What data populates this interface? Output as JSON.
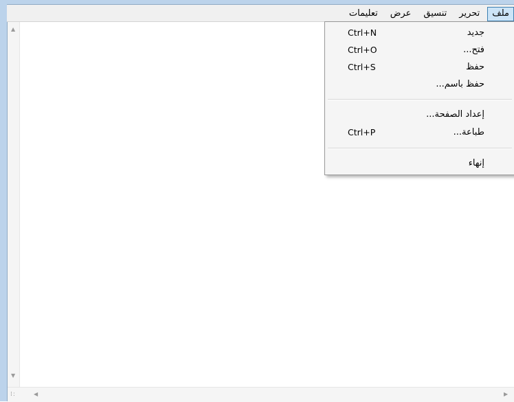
{
  "menubar": {
    "items": [
      {
        "label": "ملف",
        "active": true
      },
      {
        "label": "تحرير"
      },
      {
        "label": "تنسيق"
      },
      {
        "label": "عرض"
      },
      {
        "label": "تعليمات"
      }
    ]
  },
  "file_menu": {
    "new": {
      "label": "جديد",
      "shortcut": "Ctrl+N"
    },
    "open": {
      "label": "فتح...",
      "shortcut": "Ctrl+O"
    },
    "save": {
      "label": "حفظ",
      "shortcut": "Ctrl+S"
    },
    "save_as": {
      "label": "حفظ باسم..."
    },
    "page_setup": {
      "label": "إعداد الصفحة..."
    },
    "print": {
      "label": "طباعة...",
      "shortcut": "Ctrl+P"
    },
    "exit": {
      "label": "إنهاء"
    }
  },
  "editor": {
    "content": ""
  },
  "colors": {
    "frame": "#bcd3eb",
    "menu_active_bg": "#cce4f7",
    "menu_active_border": "#3c7fb1",
    "menu_bg": "#f5f5f5"
  }
}
